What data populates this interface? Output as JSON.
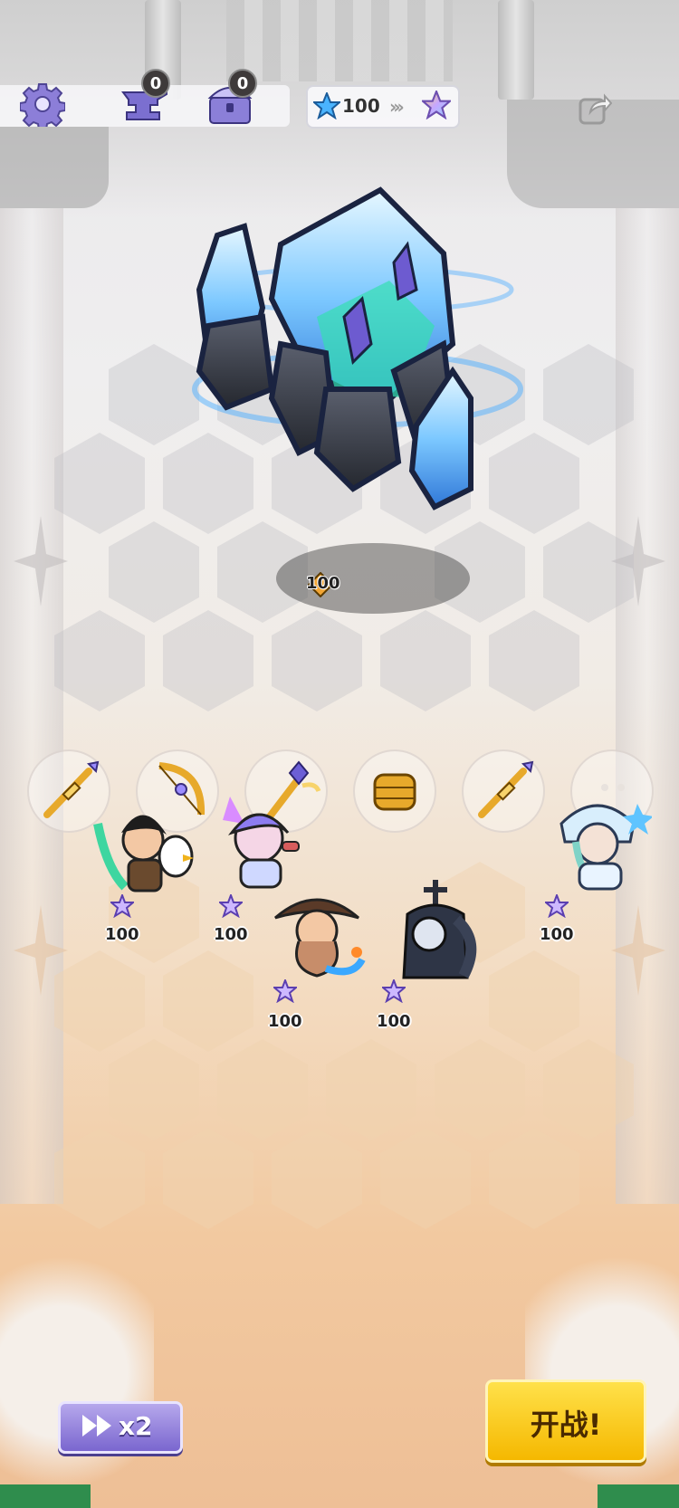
{
  "topbar": {
    "settings_icon": "gear-icon",
    "anvil_count": "0",
    "chest_count": "0",
    "star_level": "100",
    "share_icon": "share-icon"
  },
  "boss": {
    "name_icon": "ice-crystal-golem",
    "level": "100"
  },
  "items": [
    {
      "icon": "golden-spear-icon"
    },
    {
      "icon": "golden-bow-icon"
    },
    {
      "icon": "golden-scepter-icon"
    },
    {
      "icon": "golden-gauntlet-icon"
    },
    {
      "icon": "golden-spear-icon"
    },
    {
      "icon": "empty-slot-icon"
    }
  ],
  "heroes": [
    {
      "icon": "beast-tamer-hero",
      "level": "100"
    },
    {
      "icon": "mage-hero",
      "level": "100"
    },
    {
      "icon": "pirate-hero",
      "level": "100"
    },
    {
      "icon": "nun-hero",
      "level": "100"
    },
    {
      "icon": "ice-maiden-hero",
      "level": "100"
    }
  ],
  "buttons": {
    "speed_label": "x2",
    "start_label": "开战!"
  },
  "colors": {
    "accent_purple": "#7a66cf",
    "start_yellow": "#f5b800",
    "ice_blue": "#3aa8ff"
  }
}
